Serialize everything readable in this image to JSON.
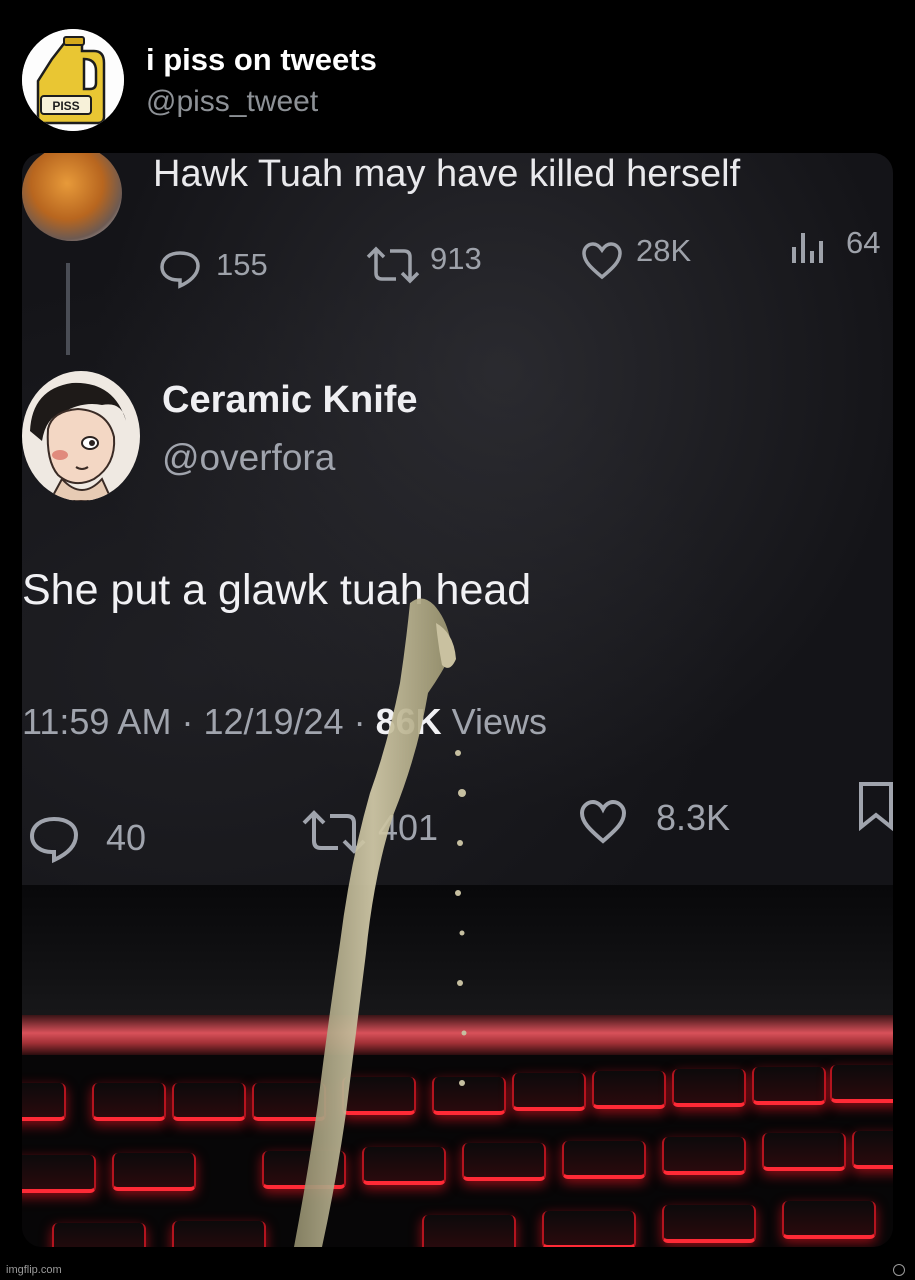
{
  "header": {
    "display_name": "i piss on tweets",
    "handle": "@piss_tweet",
    "avatar_label": "PISS"
  },
  "photo": {
    "previous_tweet": {
      "text": "Hawk Tuah may have killed herself",
      "replies": "155",
      "retweets": "913",
      "likes": "28K",
      "views": "64"
    },
    "quoted_tweet": {
      "name": "Ceramic Knife",
      "handle": "@overfora",
      "body": "She put a glawk tuah head",
      "time": "11:59 AM",
      "date": "12/19/24",
      "views_count": "86K",
      "views_label": "Views",
      "replies": "40",
      "retweets": "401",
      "likes": "8.3K"
    }
  },
  "footer": {
    "watermark": "imgflip.com"
  }
}
